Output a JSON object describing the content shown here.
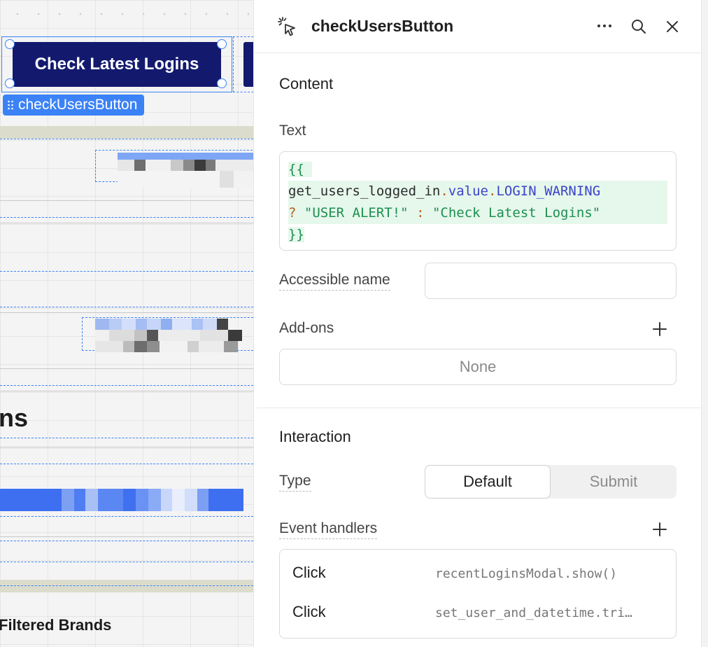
{
  "canvas": {
    "primary_button_label": "Check Latest Logins",
    "component_tag": "checkUsersButton",
    "heading_fragment": "ns",
    "bottom_heading": "Filtered Brands",
    "colors": {
      "button_bg": "#131a6e",
      "selection": "#3b82f6"
    }
  },
  "panel": {
    "title": "checkUsersButton",
    "header_icons": [
      "cursor-click-icon",
      "more-icon",
      "search-icon",
      "close-icon"
    ],
    "content": {
      "section_title": "Content",
      "text_label": "Text",
      "code": {
        "open": "{{",
        "query": "get_users_logged_in",
        "dot1": ".",
        "prop1": "value",
        "dot2": ".",
        "prop2": "LOGIN_WARNING",
        "ternary_q": "?",
        "true_str": "\"USER ALERT!\"",
        "ternary_colon": ":",
        "false_str": "\"Check Latest Logins\"",
        "close": "}}"
      },
      "accessible_name_label": "Accessible name",
      "accessible_name_value": "",
      "addons_label": "Add-ons",
      "addons_value": "None"
    },
    "interaction": {
      "section_title": "Interaction",
      "type_label": "Type",
      "type_options": [
        "Default",
        "Submit"
      ],
      "type_selected": "Default",
      "event_handlers_label": "Event handlers",
      "event_handlers": [
        {
          "event": "Click",
          "action": "recentLoginsModal.show()"
        },
        {
          "event": "Click",
          "action": "set_user_and_datetime.trigger()"
        }
      ]
    }
  }
}
